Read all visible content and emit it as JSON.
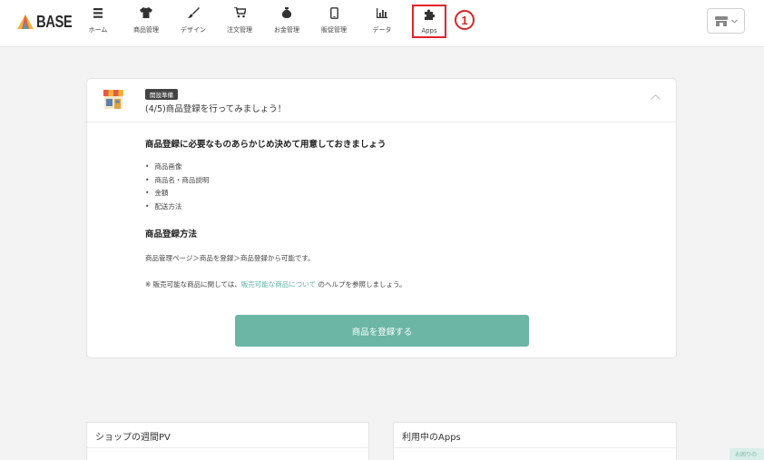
{
  "header": {
    "logo_text": "BASE",
    "nav": [
      {
        "label": "ホーム",
        "icon": "list-icon"
      },
      {
        "label": "商品管理",
        "icon": "tshirt-icon"
      },
      {
        "label": "デザイン",
        "icon": "brush-icon"
      },
      {
        "label": "注文管理",
        "icon": "cart-icon"
      },
      {
        "label": "お金管理",
        "icon": "money-bag-icon"
      },
      {
        "label": "販促管理",
        "icon": "smartphone-icon"
      },
      {
        "label": "データ",
        "icon": "bar-chart-icon"
      },
      {
        "label": "Apps",
        "icon": "puzzle-icon"
      }
    ],
    "annotation": "1",
    "highlight_color": "#e0242b"
  },
  "card": {
    "tag": "開設準備",
    "title": "(4/5)商品登録を行ってみましょう！",
    "section1_heading": "商品登録に必要なものあらかじめ決めて用意しておきましょう",
    "bullets": [
      "商品画像",
      "商品名・商品説明",
      "金額",
      "配送方法"
    ],
    "section2_heading": "商品登録方法",
    "method_text": "商品管理ページ＞商品を登録＞商品登録から可能です。",
    "note_prefix": "※ 販売可能な商品に関しては、",
    "note_link": "販売可能な商品について",
    "note_suffix": " のヘルプを参照しましょう。",
    "button_label": "商品を登録する",
    "accent_color": "#6bb6a5"
  },
  "panels": {
    "left_title": "ショップの週間PV",
    "right_title": "利用中のApps"
  },
  "help_tab": "お困りの"
}
